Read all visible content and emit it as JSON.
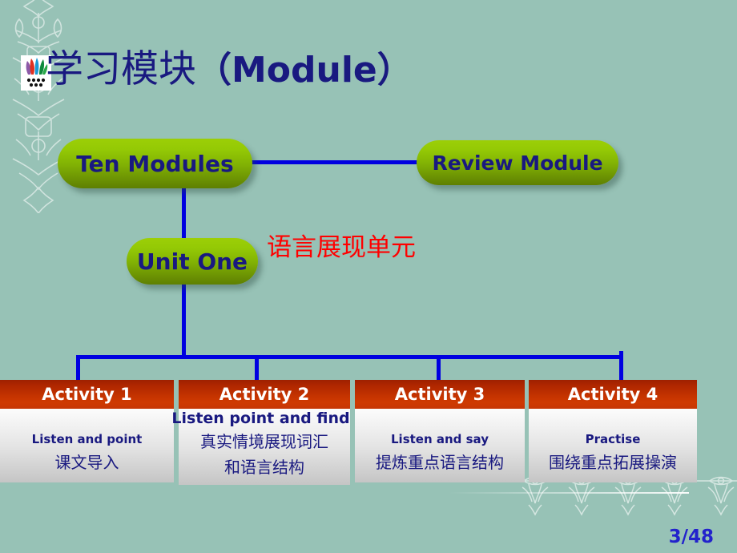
{
  "slide": {
    "background_color": "#97c2b6",
    "title_cn": "学习模块",
    "title_latin": "（Module）",
    "page_number": "3/48"
  },
  "logo": {
    "name": "publisher-leaf-logo"
  },
  "nodes": {
    "ten_modules": "Ten Modules",
    "review_module": "Review Module",
    "unit_one": "Unit One",
    "red_note": "语言展现单元"
  },
  "activities": [
    {
      "header": "Activity 1",
      "english": "Listen and point",
      "chinese": "课文导入"
    },
    {
      "header": "Activity 2",
      "english": "Listen point and find",
      "chinese_1": "真实情境展现词汇",
      "chinese_2": "和语言结构"
    },
    {
      "header": "Activity 3",
      "english": "Listen and say",
      "chinese": "提炼重点语言结构"
    },
    {
      "header": "Activity 4",
      "english": "Practise",
      "chinese": "围绕重点拓展操演"
    }
  ],
  "colors": {
    "title_blue": "#191980",
    "accent_red": "#ff0000",
    "connector_blue": "#0000e0",
    "pill_green_light": "#9ccf06",
    "pill_green_dark": "#5e7f02",
    "card_head_red": "#c43300"
  }
}
